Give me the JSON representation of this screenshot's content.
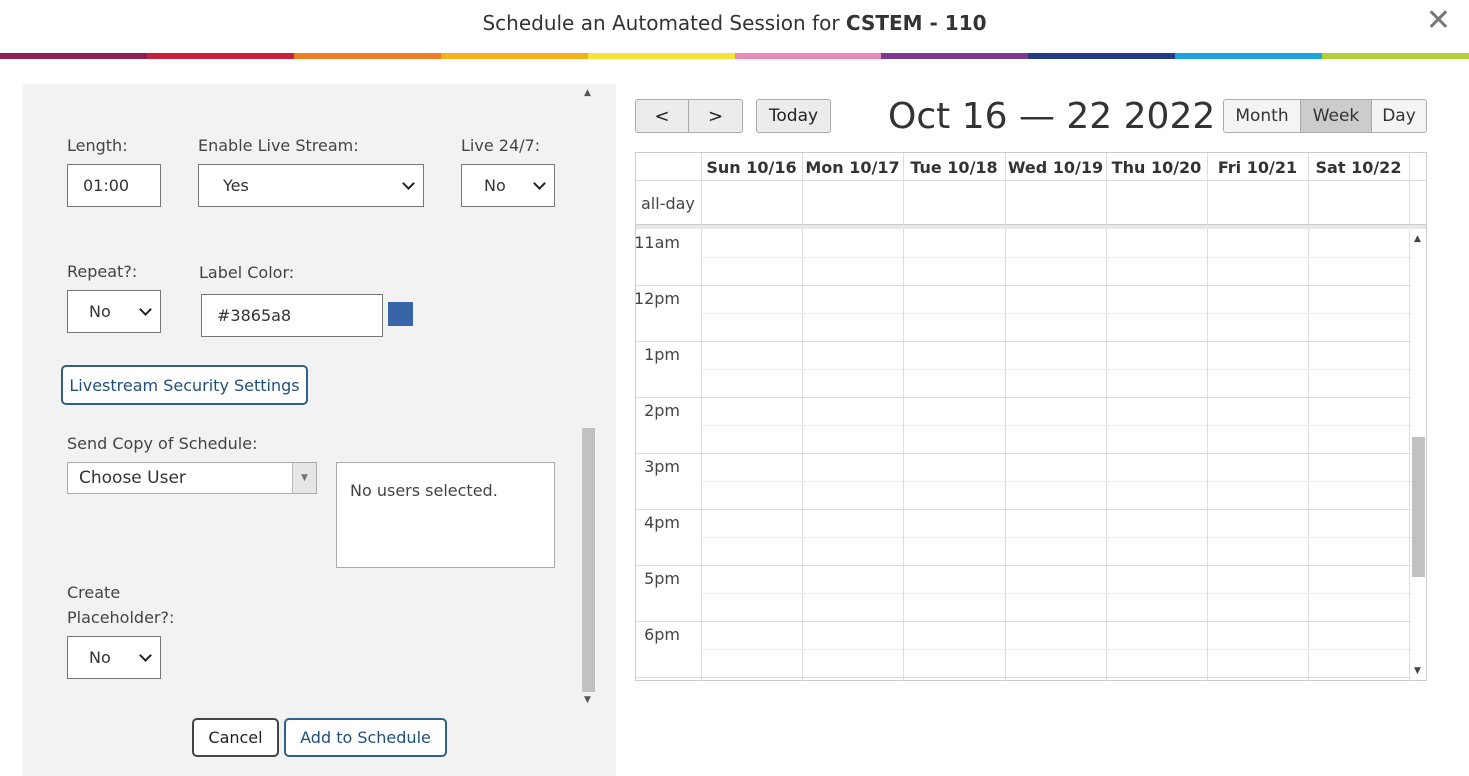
{
  "header": {
    "title_prefix": "Schedule an Automated Session for ",
    "title_room": "CSTEM - 110",
    "close_glyph": "✕",
    "stripe_colors": [
      "#8b2252",
      "#c8203a",
      "#ef7d22",
      "#f5b21a",
      "#f4e33b",
      "#e68bb5",
      "#7b3a8f",
      "#243b85",
      "#1aa6dd",
      "#b5cf37"
    ]
  },
  "form": {
    "length_label": "Length:",
    "length_value": "01:00",
    "live_stream_label": "Enable Live Stream:",
    "live_stream_value": "Yes",
    "live247_label": "Live 24/7:",
    "live247_value": "No",
    "repeat_label": "Repeat?:",
    "repeat_value": "No",
    "label_color_label": "Label Color:",
    "label_color_value": "#3865a8",
    "security_button": "Livestream Security Settings",
    "send_copy_label": "Send Copy of Schedule:",
    "choose_user": "Choose User",
    "no_users": "No users selected.",
    "placeholder_label_1": "Create",
    "placeholder_label_2": "Placeholder?:",
    "placeholder_value": "No",
    "cancel": "Cancel",
    "add": "Add to Schedule"
  },
  "calendar": {
    "prev": "<",
    "next": ">",
    "today": "Today",
    "range": "Oct 16 — 22 2022",
    "views": [
      "Month",
      "Week",
      "Day"
    ],
    "active_view": "Week",
    "days": [
      "Sun 10/16",
      "Mon 10/17",
      "Tue 10/18",
      "Wed 10/19",
      "Thu 10/20",
      "Fri 10/21",
      "Sat 10/22"
    ],
    "allday_label": "all-day",
    "times": [
      "11am",
      "12pm",
      "1pm",
      "2pm",
      "3pm",
      "4pm",
      "5pm",
      "6pm"
    ]
  }
}
